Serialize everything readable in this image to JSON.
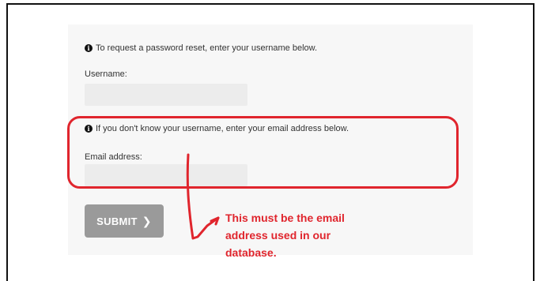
{
  "form": {
    "intro": "To request a password reset, enter your username below.",
    "username_label": "Username:",
    "username_value": "",
    "email_hint": "If you don't know your username, enter your email address below.",
    "email_label": "Email address:",
    "email_value": "",
    "submit_label": "SUBMIT"
  },
  "icons": {
    "info": "info-icon",
    "submit": "chevron-right-icon"
  },
  "annotation": {
    "line1": "This must be the email",
    "line2": "address used in our",
    "line3": "database.",
    "color": "#e0252d"
  }
}
